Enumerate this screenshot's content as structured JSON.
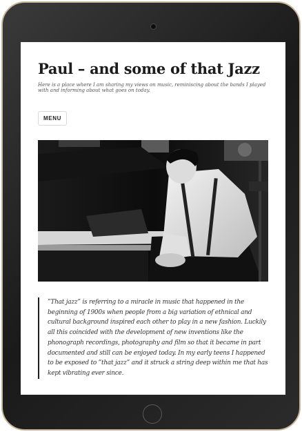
{
  "site": {
    "title": "Paul – and some of that Jazz",
    "tagline": "Here is a place where I am sharing my views on music, reminiscing about the bands I played with and informing about what goes on today."
  },
  "nav": {
    "menu_label": "MENU"
  },
  "post": {
    "quote": "”That jazz” is referring to a miracle in music that happened in the beginning of 1900s when people from a big variation of ethnical and cultural background inspired each other to play in a new fashion. Luckily all this coincided with the development of new inventions like the phonograph recordings, photography and film so that it became in part documented and still can be enjoyed today. In my early teens I happened to be exposed to ”that jazz” and it struck a string deep within me that has kept vibrating ever since."
  },
  "device": {
    "bezel_color": "#222222",
    "trim_color": "#c9b79c"
  }
}
